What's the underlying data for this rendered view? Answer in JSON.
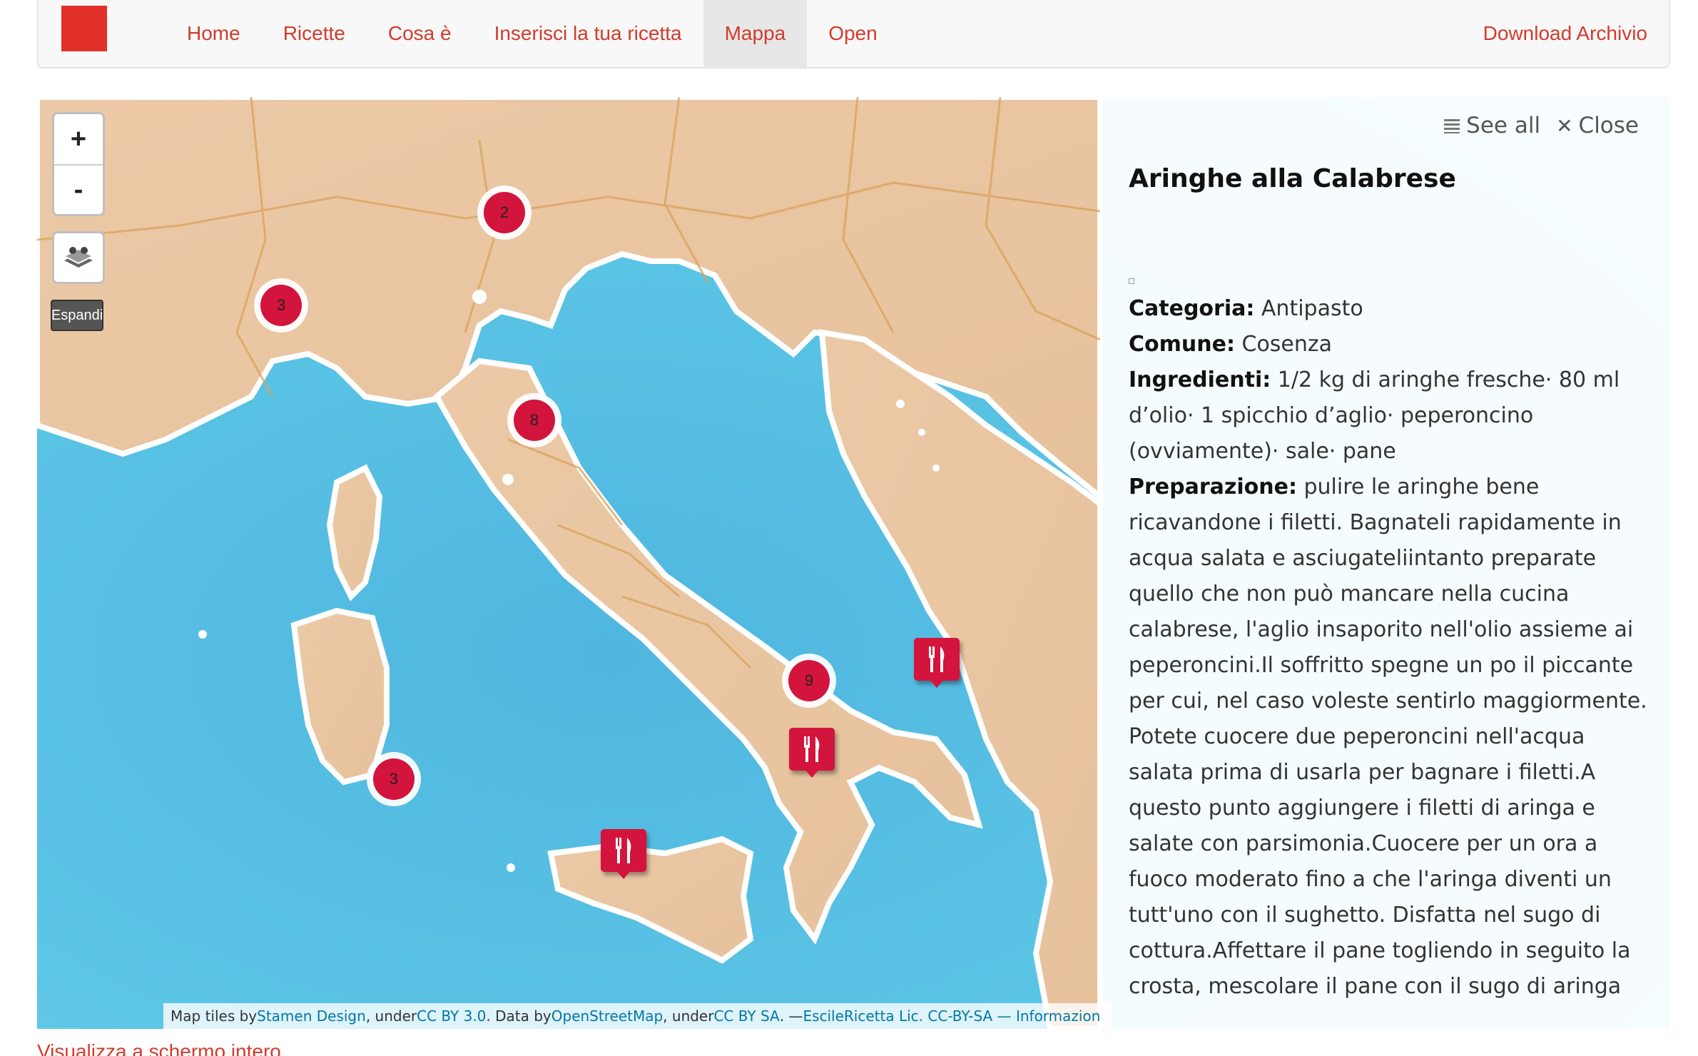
{
  "navbar": {
    "items": [
      {
        "label": "Home"
      },
      {
        "label": "Ricette"
      },
      {
        "label": "Cosa è"
      },
      {
        "label": "Inserisci la tua ricetta"
      },
      {
        "label": "Mappa",
        "active": true
      },
      {
        "label": "Open"
      }
    ],
    "right_link": "Download Archivio",
    "accent_color": "#d33b2c"
  },
  "map": {
    "controls": {
      "zoom_in": "+",
      "zoom_out": "-",
      "expand": "Espandi"
    },
    "clusters": [
      {
        "count": "2"
      },
      {
        "count": "3"
      },
      {
        "count": "8"
      },
      {
        "count": "9"
      },
      {
        "count": "3"
      }
    ],
    "pins_icon": "fork-knife-icon",
    "pin_color": "#d3143c",
    "attribution": {
      "prefix": "Map tiles by ",
      "stamen": "Stamen Design",
      "under1": ", under ",
      "cc30": "CC BY 3.0",
      "data_by": ". Data by ",
      "osm": "OpenStreetMap",
      "under2": ", under ",
      "ccbysa": "CC BY SA",
      "sep": ". — ",
      "escile": "EscileRicetta Lic. CC-BY-SA — Informazioni"
    }
  },
  "panel": {
    "see_all": "See all",
    "close": "Close",
    "title": "Aringhe alla Calabrese",
    "categoria_label": "Categoria:",
    "categoria": "Antipasto",
    "comune_label": "Comune:",
    "comune": "Cosenza",
    "ingredienti_label": "Ingredienti:",
    "ingredienti": "1/2 kg di aringhe fresche· 80 ml d’olio· 1 spicchio d’aglio· peperoncino (ovviamente)· sale· pane",
    "preparazione_label": "Preparazione:",
    "preparazione": "pulire le aringhe bene ricavandone i filetti. Bagnateli rapidamente in acqua salata e asciugateliintanto preparate quello che non può mancare nella cucina calabrese, l'aglio insaporito nell'olio assieme ai peperoncini.Il soffritto spegne un po il piccante per cui, nel caso voleste sentirlo maggiormente. Potete cuocere due peperoncini nell'acqua salata prima di usarla per bagnare i filetti.A questo punto aggiungere i filetti di aringa e salate con parsimonia.Cuocere per un ora a fuoco moderato fino a che l'aringa diventi un tutt'uno con il sughetto. Disfatta nel sugo di cottura.Affettare il pane togliendo in seguito la crosta, mescolare il pane con il sugo di aringa"
  },
  "footer": {
    "fullscreen_link": "Visualizza a schermo intero"
  }
}
